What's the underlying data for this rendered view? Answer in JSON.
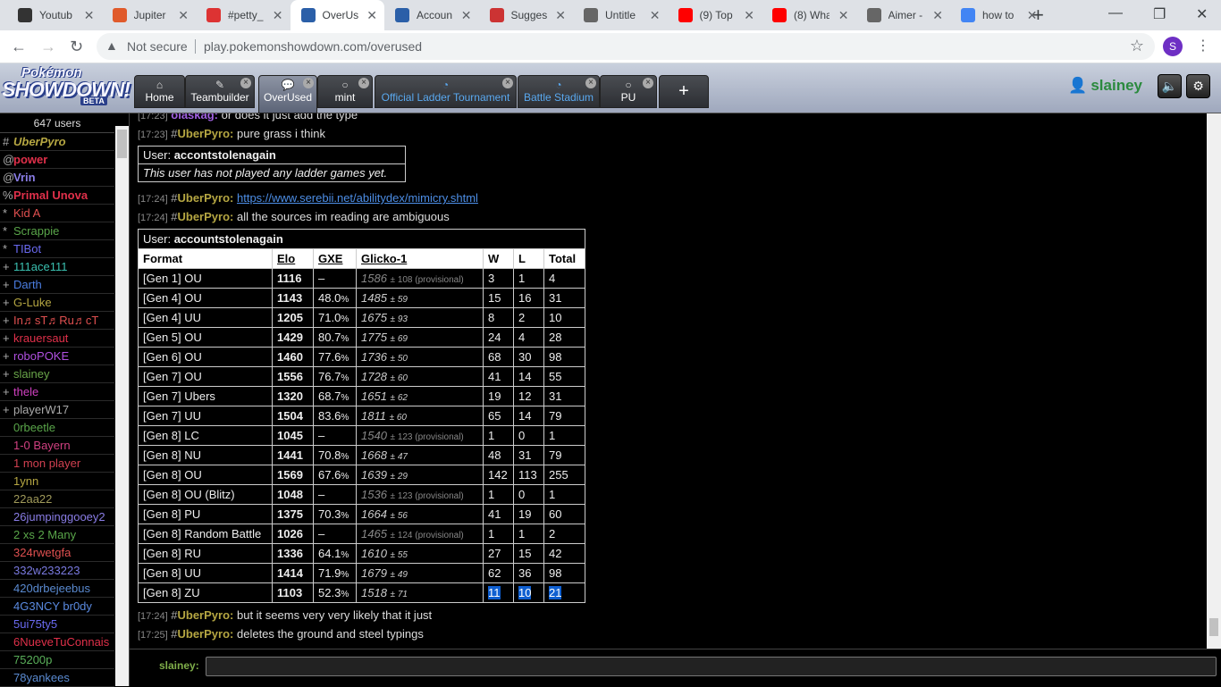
{
  "browser": {
    "tabs": [
      {
        "label": "Youtub",
        "color": "#333"
      },
      {
        "label": "Jupiter",
        "color": "#e05a2b"
      },
      {
        "label": "#petty_",
        "color": "#d33"
      },
      {
        "label": "OverUs",
        "color": "#2b5fa8"
      },
      {
        "label": "Accoun",
        "color": "#2b5fa8"
      },
      {
        "label": "Sugges",
        "color": "#c33"
      },
      {
        "label": "Untitle",
        "color": "#666"
      },
      {
        "label": "(9) Top",
        "color": "#f00"
      },
      {
        "label": "(8) Wha",
        "color": "#f00"
      },
      {
        "label": "Aimer -",
        "color": "#666"
      },
      {
        "label": "how to",
        "color": "#4285f4"
      }
    ],
    "not_secure": "Not secure",
    "url": "play.pokemonshowdown.com/overused",
    "profile_initial": "S"
  },
  "header": {
    "logo_line1": "Pokémon",
    "logo_line2": "SHOWDOWN!",
    "logo_beta": "BETA",
    "tabs": {
      "home": "Home",
      "teambuilder": "Teambuilder",
      "overused": "OverUsed",
      "mint": "mint",
      "ladder": "Official Ladder Tournament",
      "stadium": "Battle Stadium",
      "pu": "PU"
    },
    "username": "slainey"
  },
  "userlist": {
    "count": "647 users",
    "users": [
      {
        "group": "#",
        "name": "UberPyro",
        "color": "#b5a642",
        "style": "bold-italic"
      },
      {
        "group": "@",
        "name": "power",
        "color": "#e0304a",
        "style": "bold"
      },
      {
        "group": "@",
        "name": "Vrin",
        "color": "#8a7de6",
        "style": "bold"
      },
      {
        "group": "%",
        "name": "Primal Unova",
        "color": "#e0304a",
        "style": "bold"
      },
      {
        "group": "*",
        "name": "Kid A",
        "color": "#e05050",
        "style": ""
      },
      {
        "group": "*",
        "name": "Scrappie",
        "color": "#5aa64a",
        "style": ""
      },
      {
        "group": "*",
        "name": "TIBot",
        "color": "#6a6af0",
        "style": ""
      },
      {
        "group": "+",
        "name": "111ace111",
        "color": "#3ac0b0",
        "style": ""
      },
      {
        "group": "+",
        "name": "Darth",
        "color": "#4a7de0",
        "style": ""
      },
      {
        "group": "+",
        "name": "G-Luke",
        "color": "#b5a642",
        "style": ""
      },
      {
        "group": "+",
        "name": "In♬sT♬Ru♬cT",
        "color": "#e05050",
        "style": ""
      },
      {
        "group": "+",
        "name": "krauersaut",
        "color": "#e0304a",
        "style": ""
      },
      {
        "group": "+",
        "name": "roboPOKE",
        "color": "#b050e0",
        "style": ""
      },
      {
        "group": "+",
        "name": "slainey",
        "color": "#6aa64a",
        "style": ""
      },
      {
        "group": "+",
        "name": "thele",
        "color": "#d040c0",
        "style": ""
      },
      {
        "group": "+",
        "name": "playerW17",
        "color": "#aaaaaa",
        "style": ""
      },
      {
        "group": "",
        "name": "0rbeetle",
        "color": "#5aa64a",
        "style": ""
      },
      {
        "group": "",
        "name": "1-0 Bayern",
        "color": "#d04080",
        "style": ""
      },
      {
        "group": "",
        "name": "1 mon player",
        "color": "#d04050",
        "style": ""
      },
      {
        "group": "",
        "name": "1ynn",
        "color": "#b5a642",
        "style": ""
      },
      {
        "group": "",
        "name": "22aa22",
        "color": "#a09a5a",
        "style": ""
      },
      {
        "group": "",
        "name": "26jumpinggooey2",
        "color": "#8a7de6",
        "style": ""
      },
      {
        "group": "",
        "name": "2 xs 2 Many",
        "color": "#5aa64a",
        "style": ""
      },
      {
        "group": "",
        "name": "324rwetgfa",
        "color": "#e05050",
        "style": ""
      },
      {
        "group": "",
        "name": "332w233223",
        "color": "#7a7ae0",
        "style": ""
      },
      {
        "group": "",
        "name": "420drbejeebus",
        "color": "#5a8ad0",
        "style": ""
      },
      {
        "group": "",
        "name": "4G3NCY br0dy",
        "color": "#5a8ae0",
        "style": ""
      },
      {
        "group": "",
        "name": "5ui75ty5",
        "color": "#6a6af0",
        "style": ""
      },
      {
        "group": "",
        "name": "6NueveTuConnais",
        "color": "#e0304a",
        "style": ""
      },
      {
        "group": "",
        "name": "75200p",
        "color": "#5ab05a",
        "style": ""
      },
      {
        "group": "",
        "name": "78yankees",
        "color": "#5a8ad0",
        "style": ""
      }
    ]
  },
  "chat": {
    "msg0": {
      "ts": "[17:23]",
      "user": "olaskag:",
      "text": "or does it just add the type"
    },
    "msg1": {
      "ts": "[17:23]",
      "rank": "#",
      "user": "UberPyro:",
      "text": "pure grass i think"
    },
    "box1": {
      "user_label": "User:",
      "user": "accontstolenagain",
      "note": "This user has not played any ladder games yet."
    },
    "msg2": {
      "ts": "[17:24]",
      "rank": "#",
      "user": "UberPyro:",
      "link": "https://www.serebii.net/abilitydex/mimicry.shtml"
    },
    "msg3": {
      "ts": "[17:24]",
      "rank": "#",
      "user": "UberPyro:",
      "text": "all the sources im reading are ambiguous"
    },
    "msg4": {
      "ts": "[17:24]",
      "rank": "#",
      "user": "UberPyro:",
      "text": "but it seems very very likely that it just"
    },
    "msg5": {
      "ts": "[17:25]",
      "rank": "#",
      "user": "UberPyro:",
      "text": "deletes the ground and steel typings"
    },
    "input_user": "slainey:"
  },
  "ladder": {
    "user_label": "User:",
    "user": "accountstolenagain",
    "columns": [
      "Format",
      "Elo",
      "GXE",
      "Glicko-1",
      "W",
      "L",
      "Total"
    ],
    "rows": [
      {
        "format": "[Gen 1] OU",
        "elo": "1116",
        "gxe": "–",
        "gxe_small": "",
        "glicko": "1586",
        "glicko_dev": "± 108",
        "prov": "(provisional)",
        "w": "3",
        "l": "1",
        "t": "4"
      },
      {
        "format": "[Gen 4] OU",
        "elo": "1143",
        "gxe": "48.0",
        "gxe_small": "%",
        "glicko": "1485",
        "glicko_dev": "± 59",
        "prov": "",
        "w": "15",
        "l": "16",
        "t": "31"
      },
      {
        "format": "[Gen 4] UU",
        "elo": "1205",
        "gxe": "71.0",
        "gxe_small": "%",
        "glicko": "1675",
        "glicko_dev": "± 93",
        "prov": "",
        "w": "8",
        "l": "2",
        "t": "10"
      },
      {
        "format": "[Gen 5] OU",
        "elo": "1429",
        "gxe": "80.7",
        "gxe_small": "%",
        "glicko": "1775",
        "glicko_dev": "± 69",
        "prov": "",
        "w": "24",
        "l": "4",
        "t": "28"
      },
      {
        "format": "[Gen 6] OU",
        "elo": "1460",
        "gxe": "77.6",
        "gxe_small": "%",
        "glicko": "1736",
        "glicko_dev": "± 50",
        "prov": "",
        "w": "68",
        "l": "30",
        "t": "98"
      },
      {
        "format": "[Gen 7] OU",
        "elo": "1556",
        "gxe": "76.7",
        "gxe_small": "%",
        "glicko": "1728",
        "glicko_dev": "± 60",
        "prov": "",
        "w": "41",
        "l": "14",
        "t": "55"
      },
      {
        "format": "[Gen 7] Ubers",
        "elo": "1320",
        "gxe": "68.7",
        "gxe_small": "%",
        "glicko": "1651",
        "glicko_dev": "± 62",
        "prov": "",
        "w": "19",
        "l": "12",
        "t": "31"
      },
      {
        "format": "[Gen 7] UU",
        "elo": "1504",
        "gxe": "83.6",
        "gxe_small": "%",
        "glicko": "1811",
        "glicko_dev": "± 60",
        "prov": "",
        "w": "65",
        "l": "14",
        "t": "79"
      },
      {
        "format": "[Gen 8] LC",
        "elo": "1045",
        "gxe": "–",
        "gxe_small": "",
        "glicko": "1540",
        "glicko_dev": "± 123",
        "prov": "(provisional)",
        "w": "1",
        "l": "0",
        "t": "1"
      },
      {
        "format": "[Gen 8] NU",
        "elo": "1441",
        "gxe": "70.8",
        "gxe_small": "%",
        "glicko": "1668",
        "glicko_dev": "± 47",
        "prov": "",
        "w": "48",
        "l": "31",
        "t": "79"
      },
      {
        "format": "[Gen 8] OU",
        "elo": "1569",
        "gxe": "67.6",
        "gxe_small": "%",
        "glicko": "1639",
        "glicko_dev": "± 29",
        "prov": "",
        "w": "142",
        "l": "113",
        "t": "255"
      },
      {
        "format": "[Gen 8] OU (Blitz)",
        "elo": "1048",
        "gxe": "–",
        "gxe_small": "",
        "glicko": "1536",
        "glicko_dev": "± 123",
        "prov": "(provisional)",
        "w": "1",
        "l": "0",
        "t": "1"
      },
      {
        "format": "[Gen 8] PU",
        "elo": "1375",
        "gxe": "70.3",
        "gxe_small": "%",
        "glicko": "1664",
        "glicko_dev": "± 56",
        "prov": "",
        "w": "41",
        "l": "19",
        "t": "60"
      },
      {
        "format": "[Gen 8] Random Battle",
        "elo": "1026",
        "gxe": "–",
        "gxe_small": "",
        "glicko": "1465",
        "glicko_dev": "± 124",
        "prov": "(provisional)",
        "w": "1",
        "l": "1",
        "t": "2"
      },
      {
        "format": "[Gen 8] RU",
        "elo": "1336",
        "gxe": "64.1",
        "gxe_small": "%",
        "glicko": "1610",
        "glicko_dev": "± 55",
        "prov": "",
        "w": "27",
        "l": "15",
        "t": "42"
      },
      {
        "format": "[Gen 8] UU",
        "elo": "1414",
        "gxe": "71.9",
        "gxe_small": "%",
        "glicko": "1679",
        "glicko_dev": "± 49",
        "prov": "",
        "w": "62",
        "l": "36",
        "t": "98"
      },
      {
        "format": "[Gen 8] ZU",
        "elo": "1103",
        "gxe": "52.3",
        "gxe_small": "%",
        "glicko": "1518",
        "glicko_dev": "± 71",
        "prov": "",
        "w": "11",
        "l": "10",
        "t": "21",
        "selected": true
      }
    ]
  }
}
